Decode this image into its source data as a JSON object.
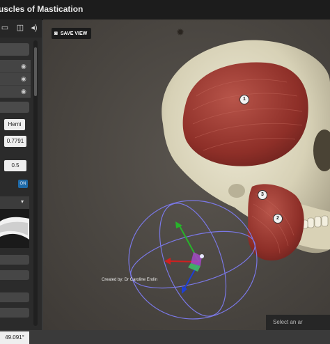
{
  "window": {
    "title": "uscles of Mastication"
  },
  "left_panel": {
    "toolbar_icons": [
      "layers-icon",
      "vr-icon",
      "sound-icon"
    ],
    "fields": {
      "label_field": "Herni",
      "value_a": "0.7791",
      "value_b": "0.5",
      "toggle": "ON",
      "bottom_value": "49.091°"
    }
  },
  "viewport": {
    "save_view_label": "SAVE VIEW",
    "credit": "Created by: Dr Caroline Erolin",
    "bottom_hint": "Select an ar",
    "muscle_labels": [
      "1",
      "3",
      "2"
    ],
    "gizmo_colors": {
      "x": "#d11f1f",
      "y": "#27b42a",
      "z": "#1d3fd6",
      "ring": "#7a78e6"
    }
  }
}
